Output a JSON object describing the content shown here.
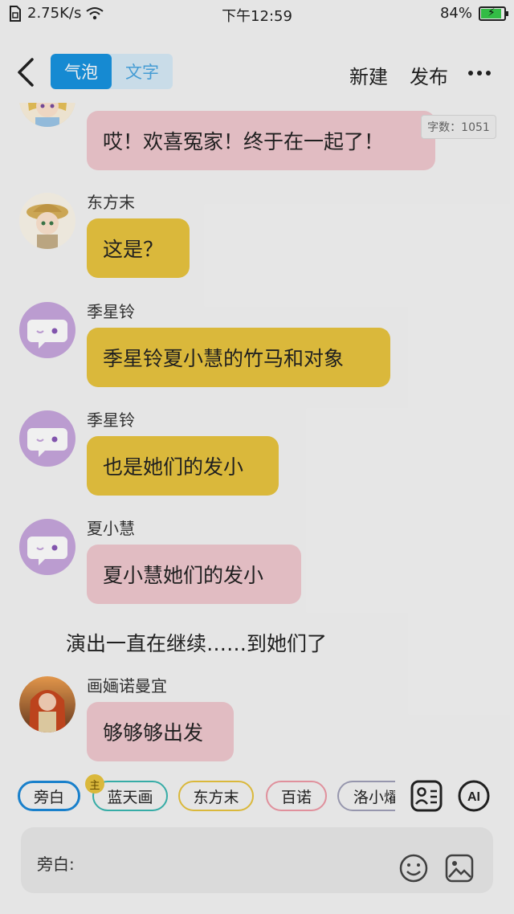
{
  "status_bar": {
    "speed": "2.75K/s",
    "time": "下午12:59",
    "battery": "84%"
  },
  "header": {
    "tabs": [
      {
        "label": "气泡",
        "active": true
      },
      {
        "label": "文字",
        "active": false
      }
    ],
    "new_label": "新建",
    "publish_label": "发布",
    "word_count": "字数：1051"
  },
  "messages": [
    {
      "type": "bubble",
      "name": "",
      "text": "哎！欢喜冤家！终于在一起了！",
      "color": "pink",
      "avatar": "girl-yellow-avatar"
    },
    {
      "type": "bubble",
      "name": "东方末",
      "text": "这是？",
      "color": "yellow",
      "avatar": "boy-hat-avatar"
    },
    {
      "type": "bubble",
      "name": "季星铃",
      "text": "季星铃夏小慧的竹马和对象",
      "color": "yellow",
      "avatar": "default-chat-avatar"
    },
    {
      "type": "bubble",
      "name": "季星铃",
      "text": "也是她们的发小",
      "color": "yellow",
      "avatar": "default-chat-avatar"
    },
    {
      "type": "bubble",
      "name": "夏小慧",
      "text": "夏小慧她们的发小",
      "color": "pink",
      "avatar": "default-chat-avatar"
    },
    {
      "type": "narration",
      "text": "演出一直在继续……到她们了"
    },
    {
      "type": "bubble",
      "name": "画婳诺曼宜",
      "text": "够够够出发",
      "color": "pink",
      "avatar": "red-hair-avatar"
    }
  ],
  "chips": [
    {
      "label": "旁白",
      "color": "#1b88d8",
      "selected": true
    },
    {
      "label": "蓝天画",
      "color": "#3ab7b1",
      "badge": "主"
    },
    {
      "label": "东方末",
      "color": "#e8c43f"
    },
    {
      "label": "百诺",
      "color": "#ee9aa6"
    },
    {
      "label": "洛小燿",
      "color": "#a0a0b8"
    }
  ],
  "input": {
    "label": "旁白:"
  },
  "colors": {
    "accent": "#1893e0",
    "bubble_pink": "#f0c8cf",
    "bubble_yellow": "#e8c43f"
  }
}
